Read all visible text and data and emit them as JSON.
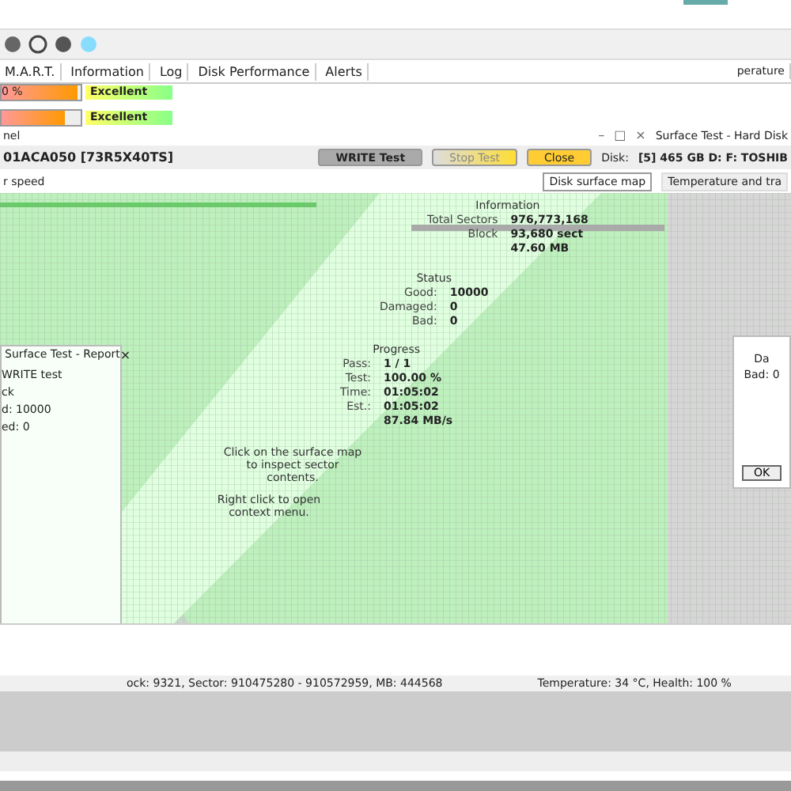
{
  "tabs": [
    {
      "label": "M.A.R.T."
    },
    {
      "label": "Information"
    },
    {
      "label": "Log"
    },
    {
      "label": "Disk Performance"
    },
    {
      "label": "Alerts"
    }
  ],
  "side_tab": "perature",
  "health_bars": [
    {
      "reading": "0 %",
      "level": 0.95,
      "rating": "Excellent"
    },
    {
      "level": 0.8,
      "rating": "Excellent"
    }
  ],
  "panel_label": "nel",
  "disk_name": "01ACA050 [73R5X40TS]",
  "buttons": [
    {
      "label": "WRITE Test",
      "kind": "mode"
    },
    {
      "label": "Stop Test",
      "kind": "stop"
    },
    {
      "label": "Close",
      "kind": "close"
    }
  ],
  "window_controls": [
    "–",
    "□",
    "×"
  ],
  "subtitle": "r speed",
  "surface_window": {
    "title": "Surface Test - Hard Disk",
    "disk_label": "Disk:",
    "disk": "[5] 465 GB D: F: TOSHIB",
    "tabs": [
      {
        "label": "Disk surface map",
        "selected": true
      },
      {
        "label": "Temperature and tra",
        "selected": false
      }
    ]
  },
  "information": {
    "title": "Information",
    "rows": [
      {
        "label": "Total Sectors",
        "value": "976,773,168"
      },
      {
        "label": "Block",
        "value": "93,680 sect"
      },
      {
        "label": "",
        "value": "47.60 MB"
      }
    ]
  },
  "status": {
    "title": "Status",
    "rows": [
      {
        "label": "Good:",
        "value": "10000"
      },
      {
        "label": "Damaged:",
        "value": "0"
      },
      {
        "label": "Bad:",
        "value": "0"
      }
    ]
  },
  "progress": {
    "title": "Progress",
    "rows": [
      {
        "label": "Pass:",
        "value": "1 / 1"
      },
      {
        "label": "Test:",
        "value": "100.00 %"
      },
      {
        "label": "Time:",
        "value": "01:05:02"
      },
      {
        "label": "Est.:",
        "value": "01:05:02"
      },
      {
        "label": "",
        "value": "87.84 MB/s"
      }
    ]
  },
  "hints": [
    "Click on the surface map to inspect sector contents.",
    "Right click to open context menu."
  ],
  "report": {
    "title": "Surface Test - Report",
    "close": "×",
    "lines": [
      "WRITE test",
      "ck",
      "d: 10000",
      "ed: 0"
    ]
  },
  "dialog": {
    "lines": [
      "Da",
      "Bad: 0"
    ],
    "button": "OK"
  },
  "status_bar": {
    "block": "ock: 9321, Sector: 910475280 - 910572959, MB: 444568",
    "health": "Temperature: 34  °C,  Health: 100 %"
  }
}
